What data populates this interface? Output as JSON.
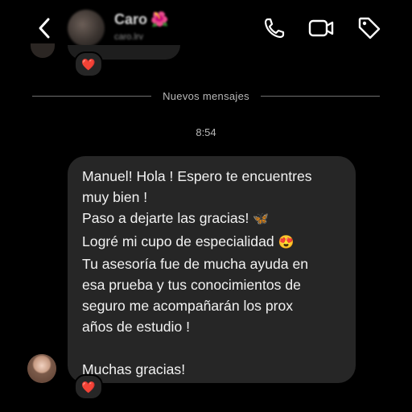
{
  "header": {
    "contact_name": "Caro",
    "contact_emoji": "🌺",
    "username": "caro.lrv",
    "icons": [
      "back-icon",
      "phone-icon",
      "video-icon",
      "tag-icon"
    ]
  },
  "thread": {
    "previous_reaction": "❤️",
    "divider_label": "Nuevos mensajes",
    "timestamp": "8:54",
    "message": {
      "lines": [
        "Manuel! Hola ! Espero te encuentres",
        "muy bien !",
        "Paso a dejarte las gracias!",
        "Logré mi cupo de especialidad",
        "Tu asesoría fue de mucha ayuda en",
        "esa prueba y tus conocimientos de",
        "seguro me acompañarán los prox",
        "años de estudio !",
        "Muchas gracias!"
      ],
      "emoji_butterfly": "🦋",
      "emoji_heart_eyes": "😍",
      "reaction": "❤️"
    }
  },
  "colors": {
    "background": "#000000",
    "bubble": "#262626",
    "text": "#f2f2f2",
    "muted": "#b8b8b8"
  }
}
